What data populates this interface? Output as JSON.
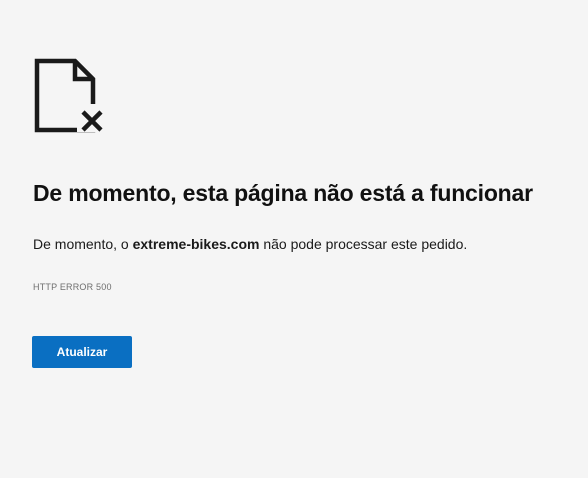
{
  "error": {
    "icon": "file-error-icon",
    "title": "De momento, esta página não está a funcionar",
    "message_prefix": "De momento, o ",
    "host": "extreme-bikes.com",
    "message_suffix": " não pode processar este pedido.",
    "code": "HTTP ERROR 500"
  },
  "actions": {
    "reload_label": "Atualizar"
  },
  "colors": {
    "background": "#f5f5f5",
    "accent": "#0a6fc2",
    "text": "#1a1a1a",
    "muted": "#6e6e6e"
  }
}
